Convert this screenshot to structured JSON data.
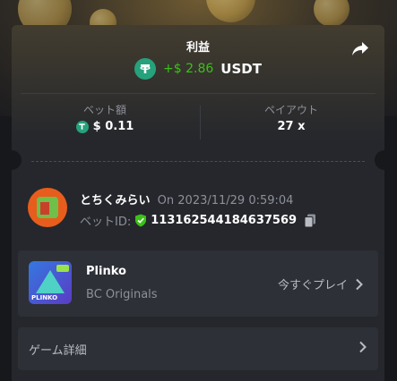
{
  "profit": {
    "title": "利益",
    "amount": "+$ 2.86",
    "currency": "USDT"
  },
  "bet": {
    "amount_label": "ベット額",
    "amount_value": "$ 0.11",
    "payout_label": "ペイアウト",
    "payout_value": "27 x"
  },
  "user": {
    "name": "とちくみらい",
    "time": "On 2023/11/29 0:59:04",
    "bet_id_label": "ベットID:",
    "bet_id_value": "113162544184637569"
  },
  "game": {
    "name": "Plinko",
    "provider": "BC Originals",
    "play_label": "今すぐプレイ",
    "thumb_label": "PLINKO"
  },
  "details": {
    "label": "ゲーム詳細"
  },
  "colors": {
    "card_bg": "#25272c",
    "row_bg": "#2d3036",
    "profit_green": "#3bc117",
    "tether_green": "#26a17b",
    "muted_text": "#8d9099",
    "page_bg": "#17181b"
  },
  "icons": [
    "tether-icon",
    "share-icon",
    "verified-shield-icon",
    "copy-icon",
    "chevron-right-icon"
  ]
}
